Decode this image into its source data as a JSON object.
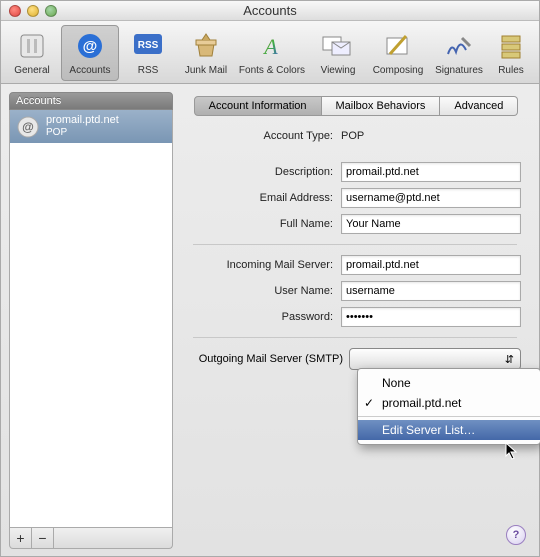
{
  "window": {
    "title": "Accounts"
  },
  "toolbar": {
    "items": [
      {
        "label": "General"
      },
      {
        "label": "Accounts"
      },
      {
        "label": "RSS"
      },
      {
        "label": "Junk Mail"
      },
      {
        "label": "Fonts & Colors"
      },
      {
        "label": "Viewing"
      },
      {
        "label": "Composing"
      },
      {
        "label": "Signatures"
      },
      {
        "label": "Rules"
      }
    ],
    "selected_index": 1
  },
  "sidebar": {
    "header": "Accounts",
    "accounts": [
      {
        "name": "promail.ptd.net",
        "type": "POP"
      }
    ],
    "add_label": "+",
    "remove_label": "−"
  },
  "tabs": {
    "items": [
      "Account Information",
      "Mailbox Behaviors",
      "Advanced"
    ],
    "selected_index": 0
  },
  "form": {
    "account_type_label": "Account Type:",
    "account_type_value": "POP",
    "description_label": "Description:",
    "description_value": "promail.ptd.net",
    "email_label": "Email Address:",
    "email_value": "username@ptd.net",
    "fullname_label": "Full Name:",
    "fullname_value": "Your Name",
    "incoming_label": "Incoming Mail Server:",
    "incoming_value": "promail.ptd.net",
    "username_label": "User Name:",
    "username_value": "username",
    "password_label": "Password:",
    "password_value": "•••••••",
    "smtp_label": "Outgoing Mail Server (SMTP)"
  },
  "smtp_menu": {
    "items": [
      {
        "label": "None",
        "checked": false
      },
      {
        "label": "promail.ptd.net",
        "checked": true
      }
    ],
    "edit_label": "Edit Server List…"
  },
  "help_label": "?"
}
